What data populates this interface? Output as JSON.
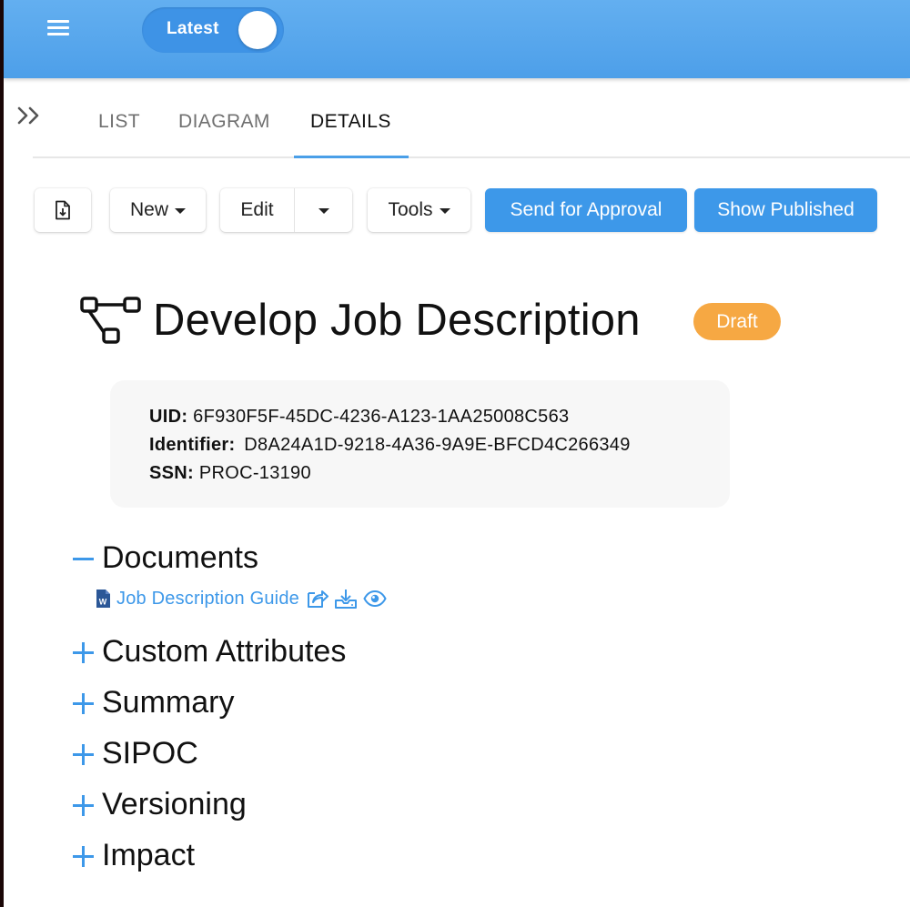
{
  "header": {
    "version_toggle_label": "Latest"
  },
  "tabs": [
    {
      "label": "LIST"
    },
    {
      "label": "DIAGRAM"
    },
    {
      "label": "DETAILS"
    }
  ],
  "toolbar": {
    "new_label": "New",
    "edit_label": "Edit",
    "tools_label": "Tools",
    "send_approval_label": "Send for Approval",
    "show_published_label": "Show Published"
  },
  "process": {
    "title": "Develop Job Description",
    "status": "Draft",
    "uid_label": "UID:",
    "uid_value": "6F930F5F-45DC-4236-A123-1AA25008C563",
    "identifier_label": "Identifier:",
    "identifier_value": "D8A24A1D-9218-4A36-9A9E-BFCD4C266349",
    "ssn_label": "SSN:",
    "ssn_value": "PROC-13190"
  },
  "sections": {
    "documents": "Documents",
    "custom_attributes": "Custom Attributes",
    "summary": "Summary",
    "sipoc": "SIPOC",
    "versioning": "Versioning",
    "impact": "Impact"
  },
  "documents": [
    {
      "name": "Job Description Guide",
      "file_type_icon": "word-file-icon"
    }
  ],
  "colors": {
    "header": "#55a5ec",
    "primary": "#3d98e9",
    "draft_badge": "#f6a843",
    "card_bg": "#f7f7f7"
  }
}
